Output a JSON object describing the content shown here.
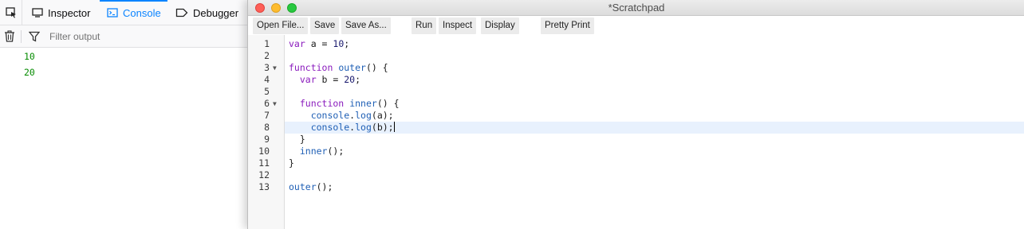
{
  "devtools": {
    "tabs": [
      {
        "label": "Inspector",
        "icon": "inspector-icon"
      },
      {
        "label": "Console",
        "icon": "console-icon",
        "active": true
      },
      {
        "label": "Debugger",
        "icon": "debugger-icon"
      }
    ],
    "filter": {
      "placeholder": "Filter output"
    },
    "output": [
      "10",
      "20"
    ]
  },
  "scratchpad": {
    "title": "*Scratchpad",
    "toolbar": {
      "open_file": "Open File...",
      "save": "Save",
      "save_as": "Save As...",
      "run": "Run",
      "inspect": "Inspect",
      "display": "Display",
      "pretty_print": "Pretty Print"
    },
    "line_numbers": [
      "1",
      "2",
      "3",
      "4",
      "5",
      "6",
      "7",
      "8",
      "9",
      "10",
      "11",
      "12",
      "13"
    ],
    "code": {
      "l1": {
        "a": "var",
        "b": " a = ",
        "c": "10",
        "d": ";"
      },
      "l3": {
        "a": "function",
        "b": " ",
        "c": "outer",
        "d": "() {"
      },
      "l4": {
        "a": "  var",
        "b": " b = ",
        "c": "20",
        "d": ";"
      },
      "l6": {
        "a": "  function",
        "b": " ",
        "c": "inner",
        "d": "() {"
      },
      "l7": {
        "a": "    console",
        "b": ".",
        "c": "log",
        "d": "(a);"
      },
      "l8": {
        "a": "    console",
        "b": ".",
        "c": "log",
        "d": "(b);"
      },
      "l9": "  }",
      "l10": {
        "a": "  inner",
        "b": "();"
      },
      "l11": "}",
      "l13": {
        "a": "outer",
        "b": "();"
      }
    }
  },
  "colors": {
    "accent": "#0a84ff",
    "console_output": "#058b00",
    "keyword": "#8a1bbd",
    "function": "#1f5fb5"
  }
}
